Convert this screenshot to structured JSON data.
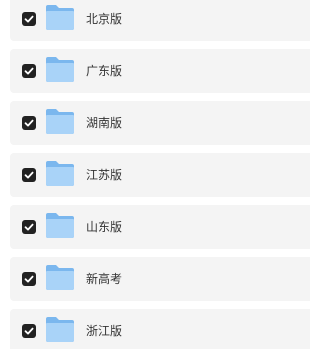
{
  "colors": {
    "row_background": "#f4f4f4",
    "checkbox_fill": "#222222",
    "checkmark": "#ffffff",
    "folder_back": "#7bb7ee",
    "folder_front": "#a9d3f8",
    "label_text": "#333333"
  },
  "items": [
    {
      "label": "北京版",
      "checked": true,
      "icon": "folder-icon"
    },
    {
      "label": "广东版",
      "checked": true,
      "icon": "folder-icon"
    },
    {
      "label": "湖南版",
      "checked": true,
      "icon": "folder-icon"
    },
    {
      "label": "江苏版",
      "checked": true,
      "icon": "folder-icon"
    },
    {
      "label": "山东版",
      "checked": true,
      "icon": "folder-icon"
    },
    {
      "label": "新高考",
      "checked": true,
      "icon": "folder-icon"
    },
    {
      "label": "浙江版",
      "checked": true,
      "icon": "folder-icon"
    }
  ]
}
